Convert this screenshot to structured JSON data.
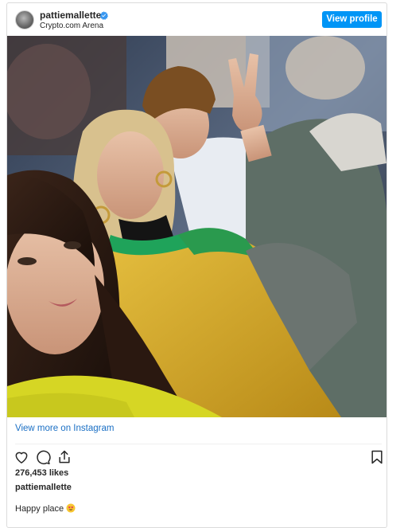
{
  "header": {
    "username": "pattiemallette",
    "location": "Crypto.com Arena",
    "verified_icon": "verified-badge-icon",
    "view_profile_label": "View profile",
    "accent_color": "#0095f6"
  },
  "post": {
    "view_more_label": "View more on Instagram",
    "likes": "276,453 likes",
    "caption_user": "pattiemallette",
    "caption_text": "Happy place",
    "caption_emoji_icon": "heart-eyes-emoji-icon"
  },
  "actions": {
    "like_icon": "heart-icon",
    "comment_icon": "comment-icon",
    "share_icon": "share-icon",
    "save_icon": "bookmark-icon"
  }
}
